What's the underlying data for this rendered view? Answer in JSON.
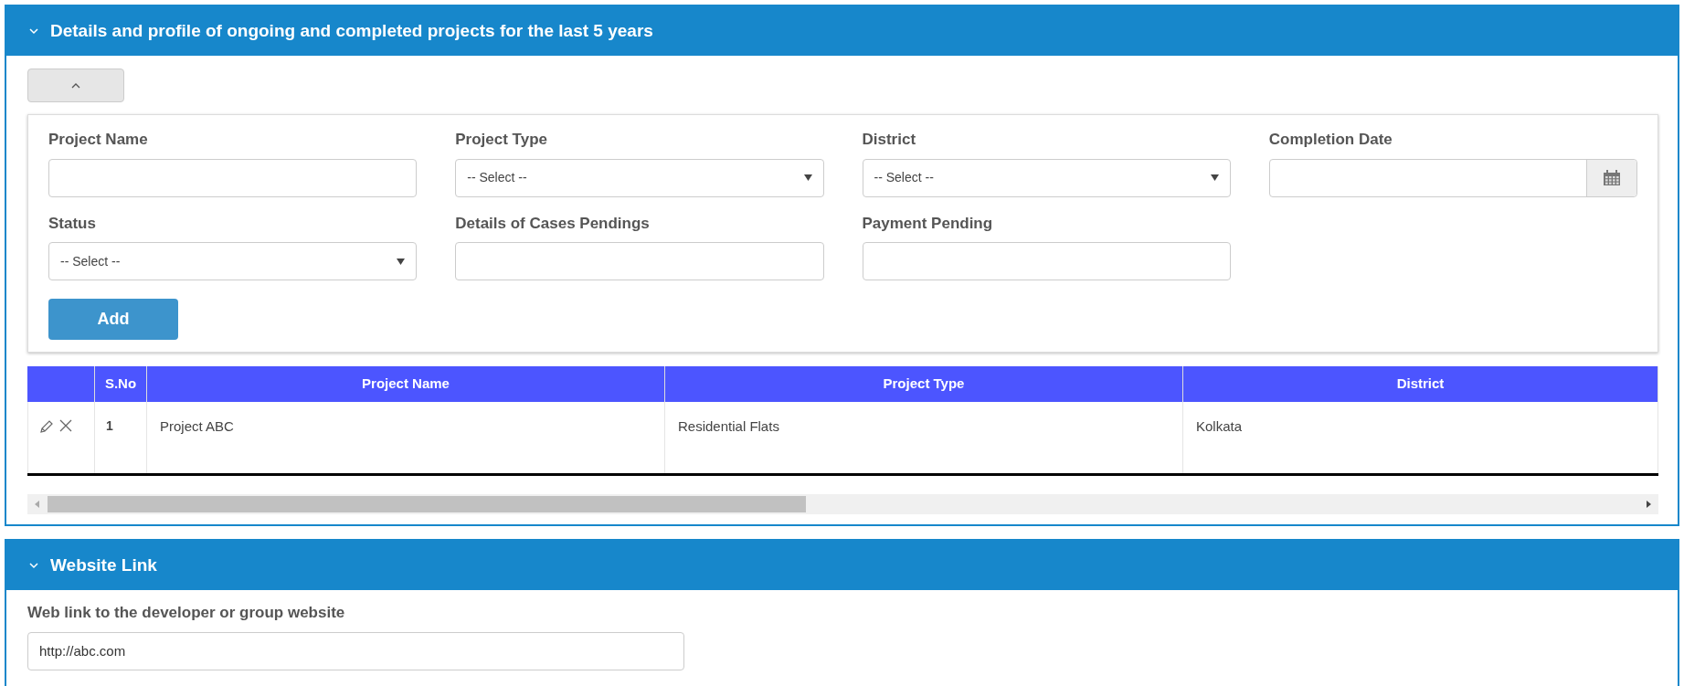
{
  "projects_panel": {
    "title": "Details and profile of ongoing and completed projects for the last 5 years",
    "expanded": true,
    "fields": [
      {
        "label": "Project Name",
        "kind": "text"
      },
      {
        "label": "Project Type",
        "kind": "select",
        "placeholder": "-- Select --"
      },
      {
        "label": "District",
        "kind": "select",
        "placeholder": "-- Select --"
      },
      {
        "label": "Completion Date",
        "kind": "date"
      },
      {
        "label": "Status",
        "kind": "select",
        "placeholder": "-- Select --"
      },
      {
        "label": "Details of Cases Pendings",
        "kind": "text"
      },
      {
        "label": "Payment Pending",
        "kind": "text"
      }
    ],
    "add_button": "Add",
    "table": {
      "columns": [
        "S.No",
        "Project Name",
        "Project Type",
        "District"
      ],
      "rows": [
        {
          "cells": [
            "1",
            "Project ABC",
            "Residential Flats",
            "Kolkata"
          ]
        }
      ]
    }
  },
  "website_panel": {
    "title": "Website Link",
    "expanded": true,
    "label": "Web link to the developer or group website",
    "value": "http://abc.com"
  }
}
